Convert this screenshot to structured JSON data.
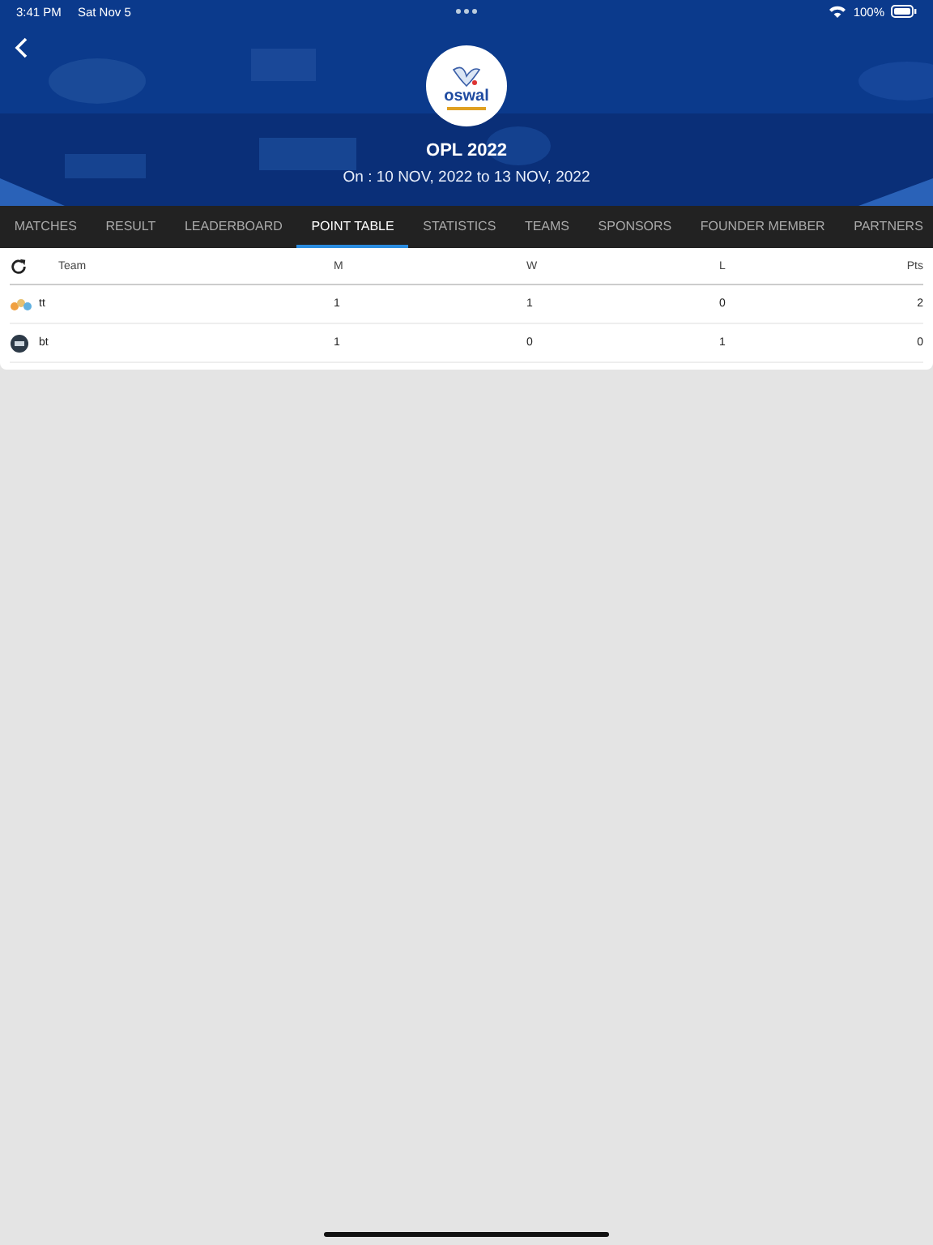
{
  "status_bar": {
    "time": "3:41 PM",
    "date": "Sat Nov 5",
    "battery": "100%"
  },
  "header": {
    "logo_text": "oswal",
    "title": "OPL 2022",
    "dates": "On : 10 NOV, 2022 to 13 NOV, 2022"
  },
  "tabs": [
    {
      "label": "MATCHES",
      "selected": false
    },
    {
      "label": "RESULT",
      "selected": false
    },
    {
      "label": "LEADERBOARD",
      "selected": false
    },
    {
      "label": "POINT TABLE",
      "selected": true
    },
    {
      "label": "STATISTICS",
      "selected": false
    },
    {
      "label": "TEAMS",
      "selected": false
    },
    {
      "label": "SPONSORS",
      "selected": false
    },
    {
      "label": "FOUNDER MEMBER",
      "selected": false
    },
    {
      "label": "PARTNERS",
      "selected": false
    }
  ],
  "table": {
    "columns": [
      "Team",
      "M",
      "W",
      "L",
      "Pts"
    ],
    "rows": [
      {
        "team": "tt",
        "m": "1",
        "w": "1",
        "l": "0",
        "pts": "2"
      },
      {
        "team": "bt",
        "m": "1",
        "w": "0",
        "l": "1",
        "pts": "0"
      }
    ]
  }
}
